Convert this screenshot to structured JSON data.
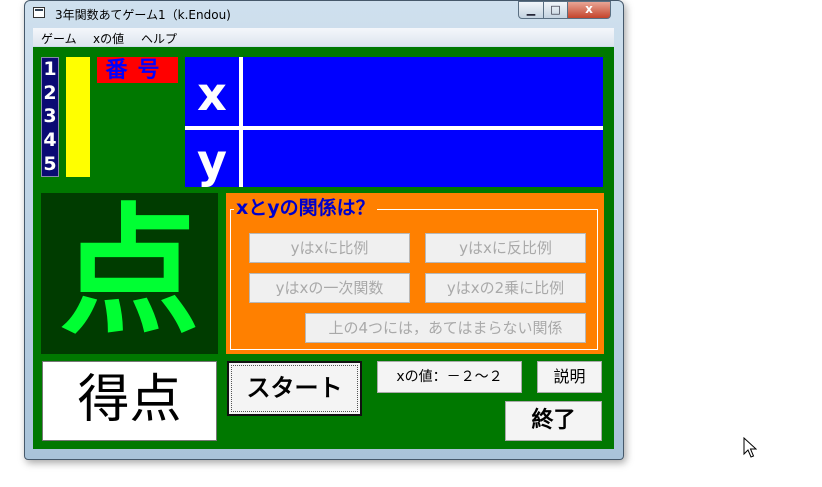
{
  "window": {
    "title": "3年関数あてゲーム1（k.Endou)",
    "controls": {
      "minimize": "▁",
      "maximize": "□",
      "close": "x"
    }
  },
  "menu": [
    "ゲーム",
    "xの値",
    "ヘルプ"
  ],
  "numbers": [
    "1",
    "2",
    "3",
    "4",
    "5"
  ],
  "bangou_label": "番号",
  "table": {
    "x_label": "x",
    "y_label": "y"
  },
  "score_kanji": "点",
  "relation": {
    "title": "xとyの関係は？",
    "answers": [
      "yはxに比例",
      "yはxに反比例",
      "yはxの一次関数",
      "yはxの2乗に比例",
      "上の4つには，あてはまらない関係"
    ]
  },
  "buttons": {
    "tokuten": "得点",
    "start": "スタート",
    "x_range": "xの値：－２～２",
    "setsumei": "説明",
    "shuryo": "終了"
  },
  "colors": {
    "client_bg": "#007800",
    "table_bg": "#0000ff",
    "relation_bg": "#ff8000",
    "score_green": "#00ff33",
    "bangou_bg": "#ff0000"
  }
}
